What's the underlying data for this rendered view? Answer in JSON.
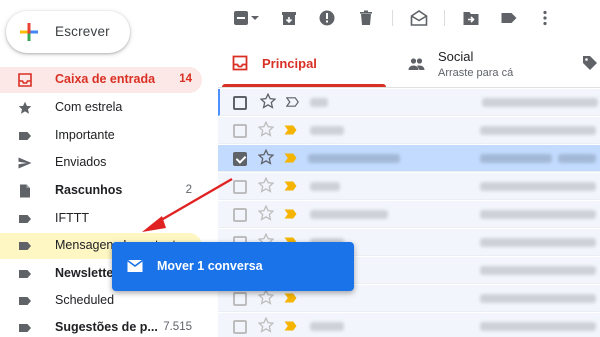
{
  "compose": {
    "label": "Escrever"
  },
  "sidebar": {
    "items": [
      {
        "label": "Caixa de entrada",
        "count": "14",
        "icon": "inbox-icon"
      },
      {
        "label": "Com estrela",
        "count": "",
        "icon": "star-icon"
      },
      {
        "label": "Importante",
        "count": "",
        "icon": "label-icon"
      },
      {
        "label": "Enviados",
        "count": "",
        "icon": "send-icon"
      },
      {
        "label": "Rascunhos",
        "count": "2",
        "icon": "draft-icon"
      },
      {
        "label": "IFTTT",
        "count": "",
        "icon": "label-icon"
      },
      {
        "label": "Mensagens Importantes",
        "count": "",
        "icon": "label-icon"
      },
      {
        "label": "Newsletter",
        "count": "",
        "icon": "label-icon"
      },
      {
        "label": "Scheduled",
        "count": "",
        "icon": "label-icon"
      },
      {
        "label": "Sugestões de p...",
        "count": "7.515",
        "icon": "label-icon"
      }
    ]
  },
  "toolbar": {
    "icons": [
      "select-checkbox-icon",
      "select-dropdown-icon",
      "archive-icon",
      "report-spam-icon",
      "delete-icon",
      "mark-read-icon",
      "move-to-icon",
      "label-as-icon",
      "more-icon"
    ]
  },
  "tabs": {
    "principal": {
      "label": "Principal"
    },
    "social": {
      "label": "Social",
      "sub": "Arraste para cá"
    }
  },
  "toast": {
    "label": "Mover 1 conversa"
  },
  "colors": {
    "accent_red": "#d93025",
    "toast_blue": "#1a73e8",
    "selected_row": "#c2dbff",
    "importance_yellow": "#f4b400"
  }
}
